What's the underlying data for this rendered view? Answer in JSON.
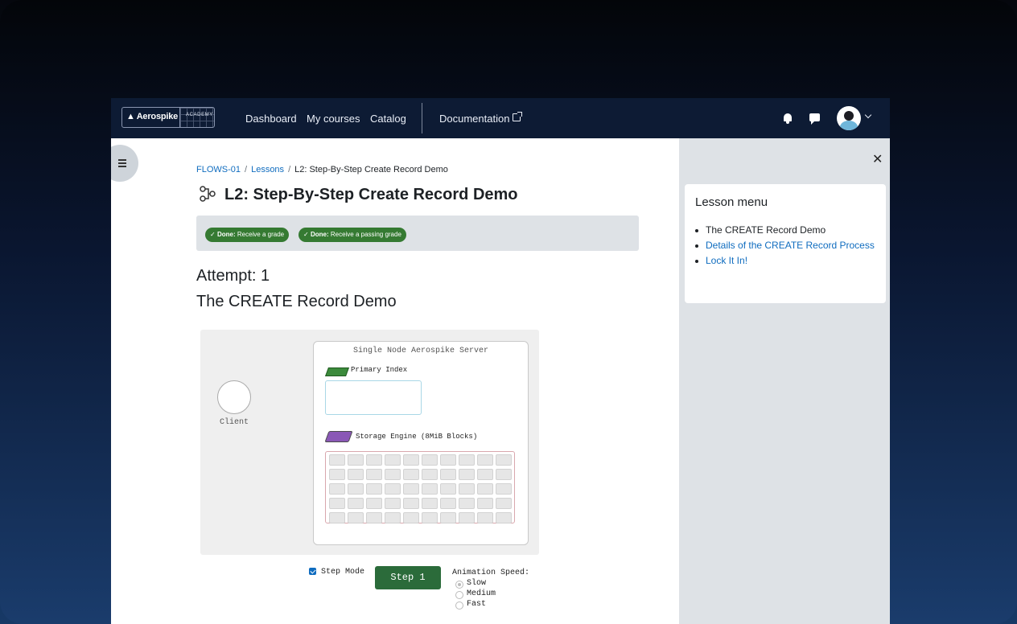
{
  "nav": {
    "brand": "Aerospike",
    "brand_sub": "ACADEMY",
    "links": [
      "Dashboard",
      "My courses",
      "Catalog"
    ],
    "documentation": "Documentation",
    "icons": [
      "bell-icon",
      "chat-icon",
      "avatar",
      "chevron-down-icon"
    ]
  },
  "breadcrumb": {
    "items": [
      "FLOWS-01",
      "Lessons",
      "L2: Step-By-Step Create Record Demo"
    ],
    "separator": "/"
  },
  "page": {
    "title": "L2: Step-By-Step Create Record Demo",
    "completion": [
      {
        "status": "Done:",
        "text": "Receive a grade"
      },
      {
        "status": "Done:",
        "text": "Receive a passing grade"
      }
    ],
    "attempt": "Attempt: 1",
    "section_title": "The CREATE Record Demo"
  },
  "simulation": {
    "client_label": "Client",
    "server_title": "Single Node Aerospike Server",
    "primary_index_label": "Primary Index",
    "storage_label": "Storage Engine (8MiB Blocks)",
    "block_columns": 10,
    "block_rows": 5
  },
  "controls": {
    "step_mode_label": "Step Mode",
    "step_mode_checked": true,
    "step_button": "Step 1",
    "speed_label": "Animation Speed:",
    "speed_options": [
      "Slow",
      "Medium",
      "Fast"
    ],
    "speed_selected": "Slow"
  },
  "lesson_menu": {
    "title": "Lesson menu",
    "items": [
      {
        "label": "The CREATE Record Demo",
        "link": false
      },
      {
        "label": "Details of the CREATE Record Process",
        "link": true
      },
      {
        "label": "Lock It In!",
        "link": true
      }
    ]
  },
  "colors": {
    "navbar": "#0d1b34",
    "link": "#0f6cbf",
    "badge": "#357a32",
    "step_button": "#2b6b3a",
    "drawer": "#dee2e6"
  }
}
